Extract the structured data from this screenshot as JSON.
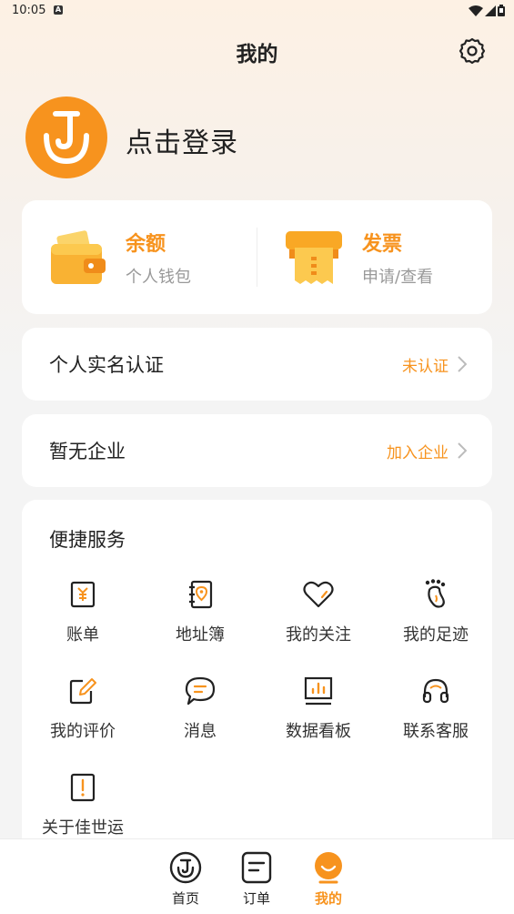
{
  "status_bar": {
    "time": "10:05",
    "notif_icon": "A"
  },
  "header": {
    "title": "我的",
    "settings_icon": "gear-icon"
  },
  "profile": {
    "login_text": "点击登录",
    "avatar_icon": "brand-j-logo"
  },
  "wallet": {
    "balance": {
      "title": "余额",
      "subtitle": "个人钱包"
    },
    "invoice": {
      "title": "发票",
      "subtitle": "申请/查看"
    }
  },
  "verification": {
    "label": "个人实名认证",
    "status": "未认证"
  },
  "enterprise": {
    "label": "暂无企业",
    "action": "加入企业"
  },
  "services": {
    "title": "便捷服务",
    "items": [
      {
        "label": "账单",
        "icon": "bill-icon"
      },
      {
        "label": "地址簿",
        "icon": "address-book-icon"
      },
      {
        "label": "我的关注",
        "icon": "heart-icon"
      },
      {
        "label": "我的足迹",
        "icon": "footprint-icon"
      },
      {
        "label": "我的评价",
        "icon": "edit-icon"
      },
      {
        "label": "消息",
        "icon": "message-icon"
      },
      {
        "label": "数据看板",
        "icon": "dashboard-icon"
      },
      {
        "label": "联系客服",
        "icon": "headset-icon"
      },
      {
        "label": "关于佳世运",
        "icon": "info-icon"
      }
    ]
  },
  "bottom_nav": {
    "items": [
      {
        "label": "首页"
      },
      {
        "label": "订单"
      },
      {
        "label": "我的"
      }
    ]
  },
  "colors": {
    "accent": "#f7931e",
    "text": "#222222",
    "muted": "#999999"
  }
}
